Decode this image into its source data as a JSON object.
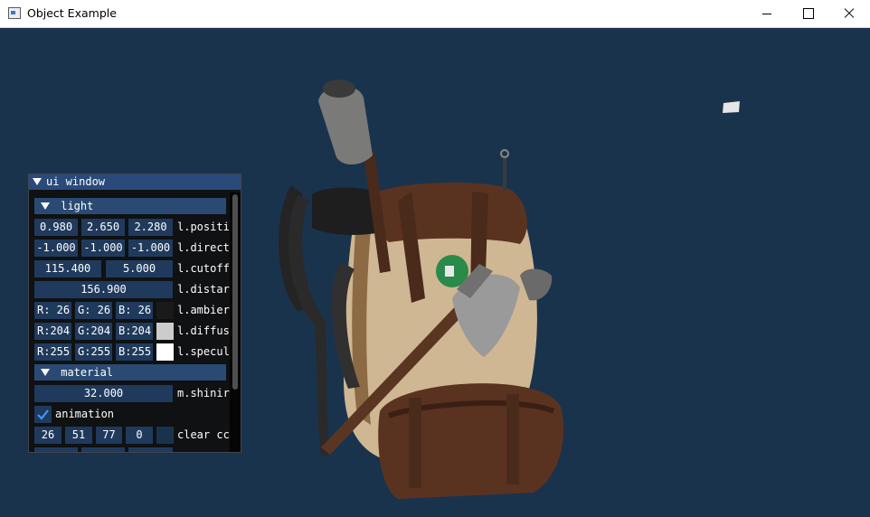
{
  "window": {
    "title": "Object Example"
  },
  "colors": {
    "clear": "#1a334d",
    "imgui_title": "#294a7a",
    "imgui_header": "#2a4a73",
    "imgui_frame": "#1f3a5c"
  },
  "ui": {
    "title": "ui window",
    "light": {
      "header": "light",
      "position": {
        "values": [
          "0.980",
          "2.650",
          "2.280"
        ],
        "label": "l.positi"
      },
      "direction": {
        "values": [
          "-1.000",
          "-1.000",
          "-1.000"
        ],
        "label": "l.direct"
      },
      "cutoff": {
        "values": [
          "115.400",
          "5.000"
        ],
        "label": "l.cutoff"
      },
      "distance": {
        "value": "156.900",
        "label": "l.distar"
      },
      "ambient": {
        "r": "R: 26",
        "g": "G: 26",
        "b": "B: 26",
        "label": "l.ambier",
        "swatch": "#1a1a1a"
      },
      "diffuse": {
        "r": "R:204",
        "g": "G:204",
        "b": "B:204",
        "label": "l.diffus",
        "swatch": "#cccccc"
      },
      "specular": {
        "r": "R:255",
        "g": "G:255",
        "b": "B:255",
        "label": "l.specul",
        "swatch": "#ffffff"
      }
    },
    "material": {
      "header": "material",
      "shininess": {
        "value": "32.000",
        "label": "m.shinir"
      }
    },
    "animation": {
      "label": "animation",
      "checked": true
    },
    "clear_color": {
      "values": [
        "26",
        "51",
        "77",
        "0"
      ],
      "label": "clear cc"
    }
  }
}
